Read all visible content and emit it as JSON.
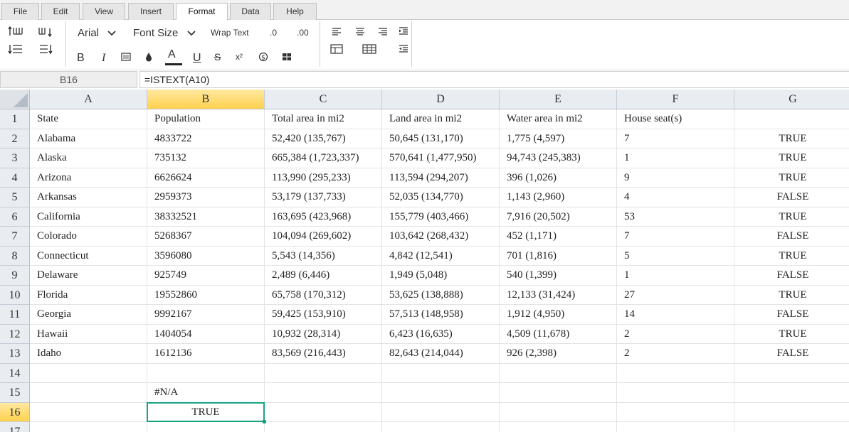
{
  "menu": {
    "tabs": [
      "File",
      "Edit",
      "View",
      "Insert",
      "Format",
      "Data",
      "Help"
    ],
    "active": "Format"
  },
  "toolbar": {
    "font_name": "Arial",
    "font_size": "Font Size",
    "wrap_text": "Wrap Text",
    "decrease_decimal": ".0",
    "increase_decimal": ".00",
    "bold": "B",
    "italic": "I",
    "font_color": "A",
    "underline": "U",
    "strike": "S",
    "superscript": "x²",
    "currency": "$",
    "accent_color": "#1aa383"
  },
  "formula_bar": {
    "name_box": "B16",
    "formula": "=ISTEXT(A10)"
  },
  "grid": {
    "columns": [
      "A",
      "B",
      "C",
      "D",
      "E",
      "F",
      "G"
    ],
    "selected_column": "B",
    "selected_row": 16,
    "row_numbers": [
      "1",
      "2",
      "3",
      "4",
      "5",
      "6",
      "7",
      "8",
      "9",
      "10",
      "11",
      "12",
      "13",
      "14",
      "15",
      "16",
      "17"
    ],
    "rows": [
      [
        "State",
        "Population",
        "Total area in mi2",
        "Land area in mi2",
        "Water area in mi2",
        "House seat(s)",
        ""
      ],
      [
        "Alabama",
        "4833722",
        "52,420 (135,767)",
        "50,645 (131,170)",
        "1,775 (4,597)",
        "7",
        "TRUE"
      ],
      [
        "Alaska",
        "735132",
        "665,384 (1,723,337)",
        "570,641 (1,477,950)",
        "94,743 (245,383)",
        "1",
        "TRUE"
      ],
      [
        "Arizona",
        "6626624",
        "113,990 (295,233)",
        "113,594 (294,207)",
        "396 (1,026)",
        "9",
        "TRUE"
      ],
      [
        "Arkansas",
        "2959373",
        "53,179 (137,733)",
        "52,035 (134,770)",
        "1,143 (2,960)",
        "4",
        "FALSE"
      ],
      [
        "California",
        "38332521",
        "163,695 (423,968)",
        "155,779 (403,466)",
        "7,916 (20,502)",
        "53",
        "TRUE"
      ],
      [
        "Colorado",
        "5268367",
        "104,094 (269,602)",
        "103,642 (268,432)",
        "452 (1,171)",
        "7",
        "FALSE"
      ],
      [
        "Connecticut",
        "3596080",
        "5,543 (14,356)",
        "4,842 (12,541)",
        "701 (1,816)",
        "5",
        "TRUE"
      ],
      [
        "Delaware",
        "925749",
        "2,489 (6,446)",
        "1,949 (5,048)",
        "540 (1,399)",
        "1",
        "FALSE"
      ],
      [
        "Florida",
        "19552860",
        "65,758 (170,312)",
        "53,625 (138,888)",
        "12,133 (31,424)",
        "27",
        "TRUE"
      ],
      [
        "Georgia",
        "9992167",
        "59,425 (153,910)",
        "57,513 (148,958)",
        "1,912 (4,950)",
        "14",
        "FALSE"
      ],
      [
        "Hawaii",
        "1404054",
        "10,932 (28,314)",
        "6,423 (16,635)",
        "4,509 (11,678)",
        "2",
        "TRUE"
      ],
      [
        "Idaho",
        "1612136",
        "83,569 (216,443)",
        "82,643 (214,044)",
        "926 (2,398)",
        "2",
        "FALSE"
      ],
      [
        "",
        "",
        "",
        "",
        "",
        "",
        ""
      ],
      [
        "",
        "#N/A",
        "",
        "",
        "",
        "",
        ""
      ],
      [
        "",
        "TRUE",
        "",
        "",
        "",
        "",
        ""
      ],
      [
        "",
        "",
        "",
        "",
        "",
        "",
        ""
      ]
    ]
  }
}
